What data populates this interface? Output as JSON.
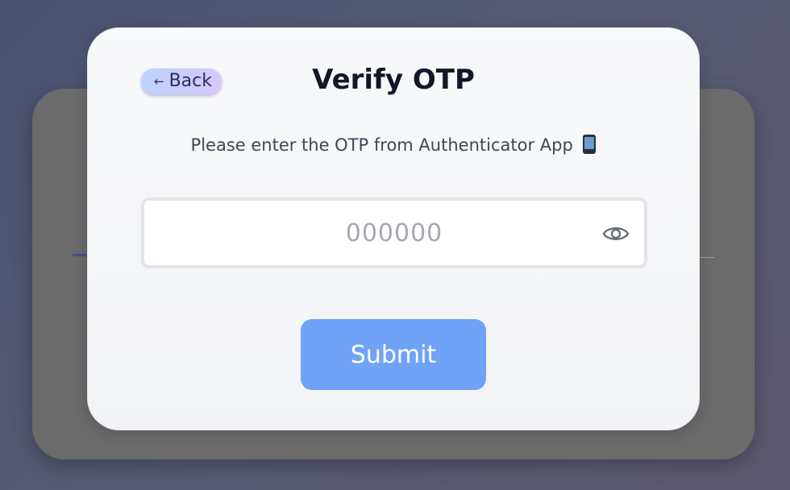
{
  "modal": {
    "back_label": "Back",
    "back_arrow": "←",
    "title": "Verify OTP",
    "subtitle": "Please enter the OTP from Authenticator App",
    "otp_input": {
      "placeholder": "000000",
      "value": ""
    },
    "submit_label": "Submit"
  },
  "icons": {
    "back": "arrow-left-icon",
    "phone": "mobile-phone-icon",
    "visibility": "eye-icon"
  },
  "colors": {
    "submit_button": "#6fa3f7",
    "back_button_start": "#bcd2ff",
    "back_button_end": "#d8c6ff",
    "title": "#121826"
  }
}
